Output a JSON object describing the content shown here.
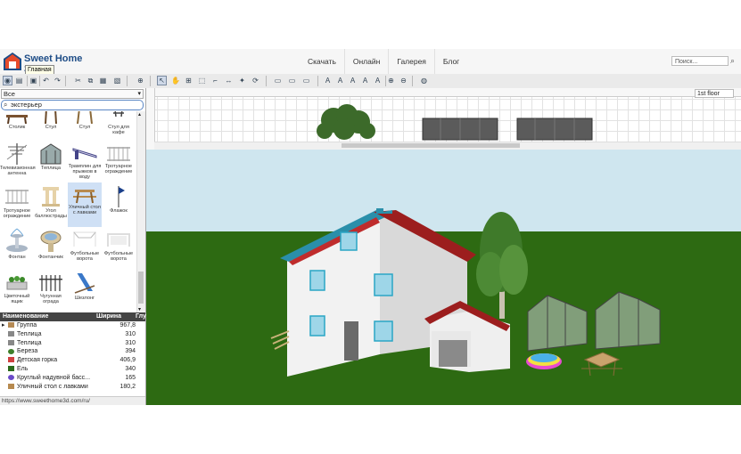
{
  "header": {
    "brand": "Sweet Home 3D",
    "tooltip": "Главная",
    "nav": [
      "Скачать",
      "Онлайн",
      "Галерея",
      "Блог"
    ],
    "search_placeholder": "Поиск..."
  },
  "catalog": {
    "category": "Все",
    "filter_text": "экстерьер",
    "items": [
      {
        "label": "Столик",
        "icon": "table-icon"
      },
      {
        "label": "Стул",
        "icon": "chair-icon"
      },
      {
        "label": "Стул",
        "icon": "chair-icon"
      },
      {
        "label": "Стул для кафе",
        "icon": "cafe-chair-icon"
      },
      {
        "label": "Телевизионная антенна",
        "icon": "antenna-icon"
      },
      {
        "label": "Теплица",
        "icon": "greenhouse-icon"
      },
      {
        "label": "Трамплин для прыжков в воду",
        "icon": "diving-board-icon"
      },
      {
        "label": "Тротуарное ограждение",
        "icon": "fence-icon"
      },
      {
        "label": "Тротуарное ограждение",
        "icon": "fence-icon"
      },
      {
        "label": "Угол баллюстрады",
        "icon": "balustrade-icon"
      },
      {
        "label": "Уличный стол с лавками",
        "icon": "picnic-table-icon",
        "selected": true
      },
      {
        "label": "Флажок",
        "icon": "flag-icon"
      },
      {
        "label": "Фонтан",
        "icon": "fountain-icon"
      },
      {
        "label": "Фонтанчик",
        "icon": "birdbath-icon"
      },
      {
        "label": "Футбольные ворота",
        "icon": "goal-icon"
      },
      {
        "label": "Футбольные ворота",
        "icon": "goal-icon"
      },
      {
        "label": "Цветочный ящик",
        "icon": "flower-box-icon"
      },
      {
        "label": "Чугунная ограда",
        "icon": "iron-fence-icon"
      },
      {
        "label": "Шезлонг",
        "icon": "deck-chair-icon"
      }
    ]
  },
  "furniture_table": {
    "columns": [
      "Наименование",
      "Ширина",
      "Глу"
    ],
    "rows": [
      {
        "name": "Группа",
        "width": "967,8",
        "icon": "group-icon",
        "expandable": true
      },
      {
        "name": "Теплица",
        "width": "310",
        "icon": "greenhouse-icon"
      },
      {
        "name": "Теплица",
        "width": "310",
        "icon": "greenhouse-icon"
      },
      {
        "name": "Береза",
        "width": "394",
        "icon": "tree-icon"
      },
      {
        "name": "Детская горка",
        "width": "406,9",
        "icon": "slide-icon"
      },
      {
        "name": "Ель",
        "width": "340",
        "icon": "fir-icon"
      },
      {
        "name": "Круглый надувной басс...",
        "width": "165",
        "icon": "pool-icon"
      },
      {
        "name": "Уличный стол с лавками",
        "width": "180,2",
        "icon": "picnic-table-icon"
      }
    ]
  },
  "status_url": "https://www.sweethome3d.com/ru/",
  "plan": {
    "level": "1st floor"
  },
  "colors": {
    "sky": "#cfe6ef",
    "grass": "#2d6a12",
    "roof": "#9c1e1e",
    "roof_trim": "#2a8faa",
    "wall": "#f1f1f1"
  }
}
